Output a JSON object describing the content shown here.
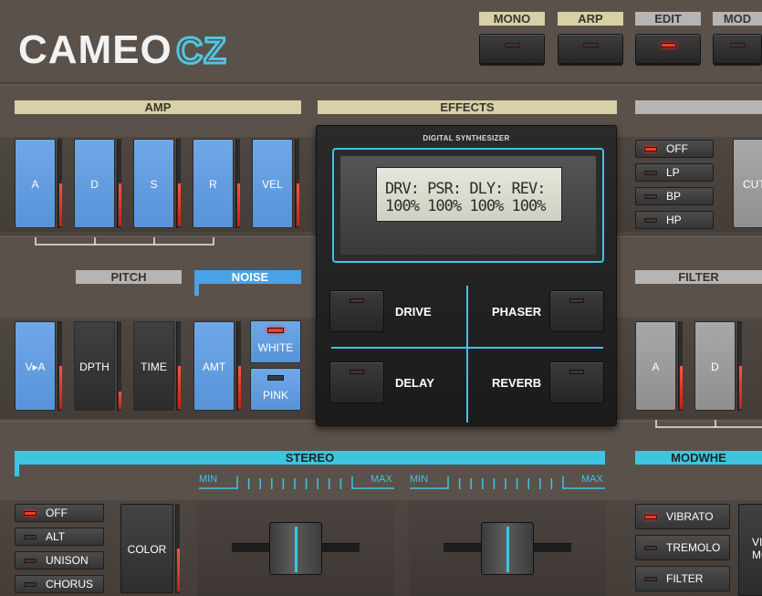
{
  "brand": {
    "name": "CAMEO",
    "model": "CZ"
  },
  "top_modes": [
    {
      "label": "MONO",
      "active": false
    },
    {
      "label": "ARP",
      "active": false
    },
    {
      "label": "EDIT",
      "active": true
    },
    {
      "label": "MOD",
      "active": false
    }
  ],
  "sections": {
    "amp": "AMP",
    "effects": "EFFECTS",
    "pitch": "PITCH",
    "noise": "NOISE",
    "filter": "FILTER",
    "stereo": "STEREO",
    "modwheel": "MODWHE"
  },
  "amp_keys": [
    {
      "label": "A",
      "level": 0.5
    },
    {
      "label": "D",
      "level": 0.5
    },
    {
      "label": "S",
      "level": 0.5
    },
    {
      "label": "R",
      "level": 0.5
    },
    {
      "label": "VEL",
      "level": 0.5
    }
  ],
  "pitch_keys": [
    {
      "label": "V▸A",
      "level": 0.5
    },
    {
      "label": "DPTH",
      "level": 0.2
    },
    {
      "label": "TIME",
      "level": 0.5
    }
  ],
  "noise": {
    "amt_label": "AMT",
    "amt_level": 0.5,
    "white_label": "WHITE",
    "pink_label": "PINK",
    "white_active": true
  },
  "filter_modes": [
    {
      "label": "OFF",
      "active": true
    },
    {
      "label": "LP",
      "active": false
    },
    {
      "label": "BP",
      "active": false
    },
    {
      "label": "HP",
      "active": false
    }
  ],
  "filter_cutoff_label": "CUT",
  "filter_keys": [
    {
      "label": "A",
      "level": 0.5
    },
    {
      "label": "D",
      "level": 0.5
    }
  ],
  "fx": {
    "header": "DIGITAL SYNTHESIZER",
    "lcd_line1": "DRV: PSR: DLY: REV:",
    "lcd_line2": "100% 100% 100% 100%",
    "drive": "DRIVE",
    "phaser": "PHASER",
    "delay": "DELAY",
    "reverb": "REVERB"
  },
  "stereo_modes": [
    {
      "label": "OFF",
      "active": true
    },
    {
      "label": "ALT",
      "active": false
    },
    {
      "label": "UNISON",
      "active": false
    },
    {
      "label": "CHORUS",
      "active": false
    }
  ],
  "stereo_color": {
    "label": "COLOR",
    "level": 0.5
  },
  "scale": {
    "min": "MIN",
    "max": "MAX"
  },
  "sliders": [
    {
      "value": 0.5
    },
    {
      "value": 0.5
    }
  ],
  "modwheel_modes": [
    {
      "label": "VIBRATO",
      "active": true
    },
    {
      "label": "TREMOLO",
      "active": false
    },
    {
      "label": "FILTER",
      "active": false
    }
  ],
  "modwheel_side_label": "VI MO"
}
